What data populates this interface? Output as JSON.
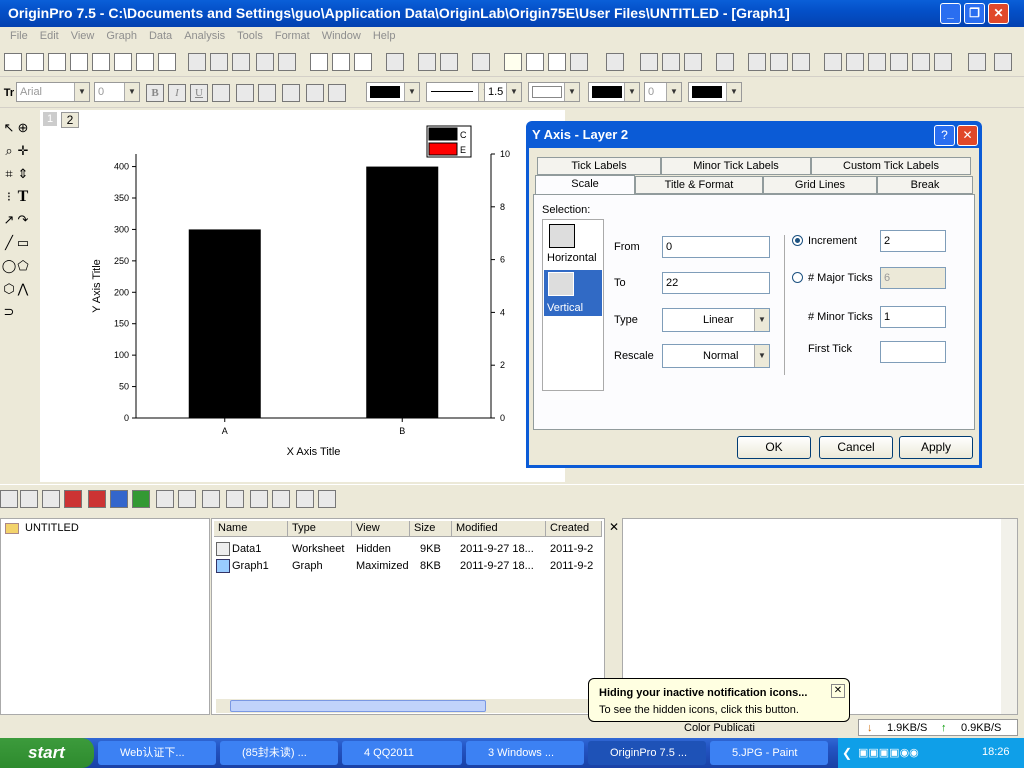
{
  "window": {
    "title": "OriginPro 7.5 - C:\\Documents and Settings\\guo\\Application Data\\OriginLab\\Origin75E\\User Files\\UNTITLED - [Graph1]"
  },
  "menu": [
    "File",
    "Edit",
    "View",
    "Graph",
    "Data",
    "Analysis",
    "Tools",
    "Format",
    "Window",
    "Help"
  ],
  "format_bar": {
    "font": "Arial",
    "size": "0",
    "bold": "B",
    "italic": "I",
    "underline": "U",
    "line_width": "1.5",
    "num": "0"
  },
  "layer_tabs": [
    "1",
    "2"
  ],
  "chart_data": {
    "type": "bar",
    "categories": [
      "A",
      "B"
    ],
    "values": [
      300,
      400
    ],
    "xlabel": "X Axis Title",
    "ylabel": "Y Axis Title",
    "ylim": [
      0,
      420
    ],
    "yticks": [
      0,
      50,
      100,
      150,
      200,
      250,
      300,
      350,
      400
    ],
    "right_ylim": [
      0,
      10
    ],
    "right_yticks": [
      0,
      2,
      4,
      6,
      8,
      10
    ],
    "legend": [
      {
        "name": "C",
        "color": "#000000"
      },
      {
        "name": "E",
        "color": "#ff0000"
      }
    ],
    "legend_position": "top-right"
  },
  "dialog": {
    "title": "Y Axis - Layer 2",
    "tabs_row1": [
      "Tick Labels",
      "Minor Tick Labels",
      "Custom Tick Labels"
    ],
    "tabs_row2": [
      "Scale",
      "Title & Format",
      "Grid Lines",
      "Break"
    ],
    "selection_label": "Selection:",
    "selection_items": [
      "Horizontal",
      "Vertical"
    ],
    "from_label": "From",
    "from_value": "0",
    "to_label": "To",
    "to_value": "22",
    "type_label": "Type",
    "type_value": "Linear",
    "rescale_label": "Rescale",
    "rescale_value": "Normal",
    "increment_label": "Increment",
    "increment_value": "2",
    "major_ticks_label": "# Major Ticks",
    "major_ticks_value": "6",
    "minor_ticks_label": "# Minor Ticks",
    "minor_ticks_value": "1",
    "first_tick_label": "First Tick",
    "first_tick_value": "",
    "ok": "OK",
    "cancel": "Cancel",
    "apply": "Apply"
  },
  "explorer": {
    "folder": "UNTITLED",
    "columns": [
      "Name",
      "Type",
      "View",
      "Size",
      "Modified",
      "Created"
    ],
    "rows": [
      {
        "name": "Data1",
        "type": "Worksheet",
        "view": "Hidden",
        "size": "9KB",
        "modified": "2011-9-27 18...",
        "created": "2011-9-2"
      },
      {
        "name": "Graph1",
        "type": "Graph",
        "view": "Maximized",
        "size": "8KB",
        "modified": "2011-9-27 18...",
        "created": "2011-9-2"
      }
    ]
  },
  "status": {
    "text": "Color Publicati"
  },
  "balloon": {
    "title": "Hiding your inactive notification icons...",
    "body": "To see the hidden icons, click this button."
  },
  "taskbar": {
    "start": "start",
    "tasks": [
      "Web认证下...",
      "(85封未读) ...",
      "4 QQ2011",
      "3 Windows ...",
      "OriginPro 7.5 ...",
      "5.JPG - Paint"
    ],
    "down_speed": "1.9KB/S",
    "up_speed": "0.9KB/S",
    "clock": "18:26"
  }
}
